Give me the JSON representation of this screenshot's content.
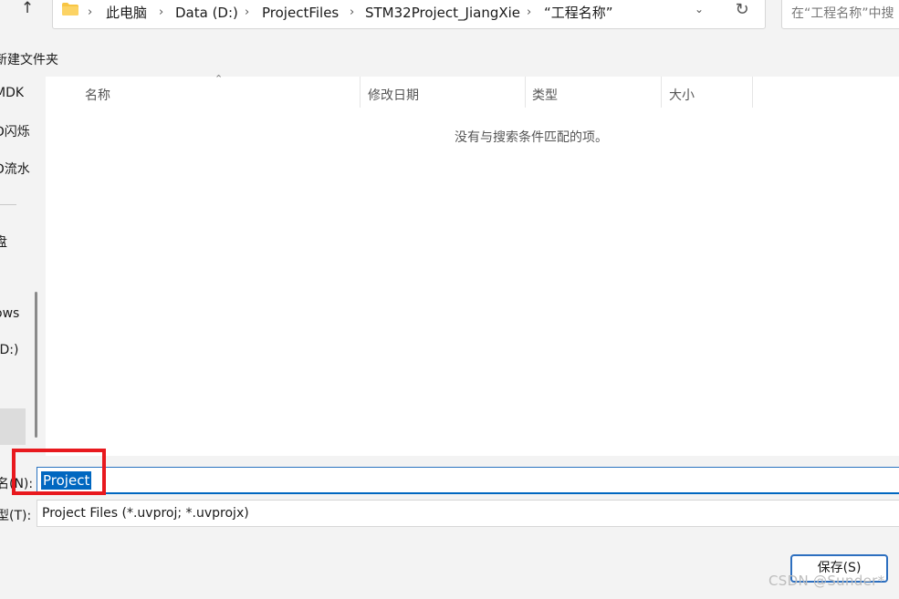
{
  "addressbar": {
    "breadcrumbs": [
      "此电脑",
      "Data (D:)",
      "ProjectFiles",
      "STM32Project_JiangXie",
      "“工程名称”"
    ],
    "separator": "›",
    "search_placeholder": "在“工程名称”中搜"
  },
  "icons": {
    "up": "up-arrow-icon",
    "folder": "folder-icon",
    "chevron": "chevron-down-icon",
    "refresh": "refresh-icon",
    "sort": "sort-up-icon"
  },
  "toolbar": {
    "new_folder": "新建文件夹"
  },
  "nav": {
    "items": [
      "MDK",
      "D闪烁",
      "D流水",
      "盘",
      "ows",
      "(D:)"
    ]
  },
  "filelist": {
    "columns": [
      "名称",
      "修改日期",
      "类型",
      "大小"
    ],
    "empty_message": "没有与搜索条件匹配的项。"
  },
  "form": {
    "filename_label": "名(N):",
    "filename_value": "Project",
    "filetype_label": "型(T):",
    "filetype_value": "Project Files (*.uvproj; *.uvprojx)"
  },
  "buttons": {
    "save": "保存(S)"
  },
  "watermark": "CSDN @Sunder*",
  "colors": {
    "accent": "#0067c0",
    "highlight": "#e8191e"
  }
}
